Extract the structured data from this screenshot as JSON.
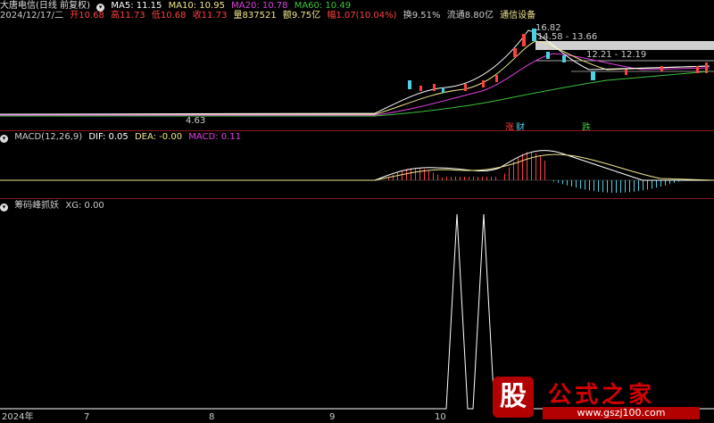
{
  "header": {
    "stock_name": "大唐电信(日线 前复权)",
    "ma5": "MA5: 11.15",
    "ma10": "MA10: 10.95",
    "ma20": "MA20: 10.78",
    "ma60": "MA60: 10.49",
    "date": "2024/12/17/二",
    "open": "开10.68",
    "high": "高11.73",
    "low": "低10.68",
    "close": "收11.73",
    "volume": "量837521",
    "amount": "额9.75亿",
    "change": "幅1.07(10.04%)",
    "turnover": "换9.51%",
    "float": "流通8.80亿",
    "sector": "通信设备"
  },
  "price_chart": {
    "labels": {
      "high_peak": "16.82",
      "range1": "14.58 - 13.66",
      "range2": "12.21 - 12.19",
      "low": "4.63"
    },
    "badges": {
      "zhang": "涨",
      "cai": "财",
      "die": "跌"
    },
    "colors": {
      "ma5": "#ffffff",
      "ma10": "#f0e68c",
      "ma20": "#e040e0",
      "ma60": "#3cc23c"
    }
  },
  "macd": {
    "title": "MACD(12,26,9)",
    "dif": "DIF: 0.05",
    "dea": "DEA: -0.00",
    "macd": "MACD: 0.11"
  },
  "indicator": {
    "title": "筹码峰抓妖",
    "xg": "XG: 0.00"
  },
  "x_axis": {
    "labels": [
      "2024年",
      "7",
      "8",
      "9",
      "10"
    ]
  },
  "watermark": {
    "gu": "股",
    "title": "公式之家",
    "url": "www.gszj100.com"
  }
}
